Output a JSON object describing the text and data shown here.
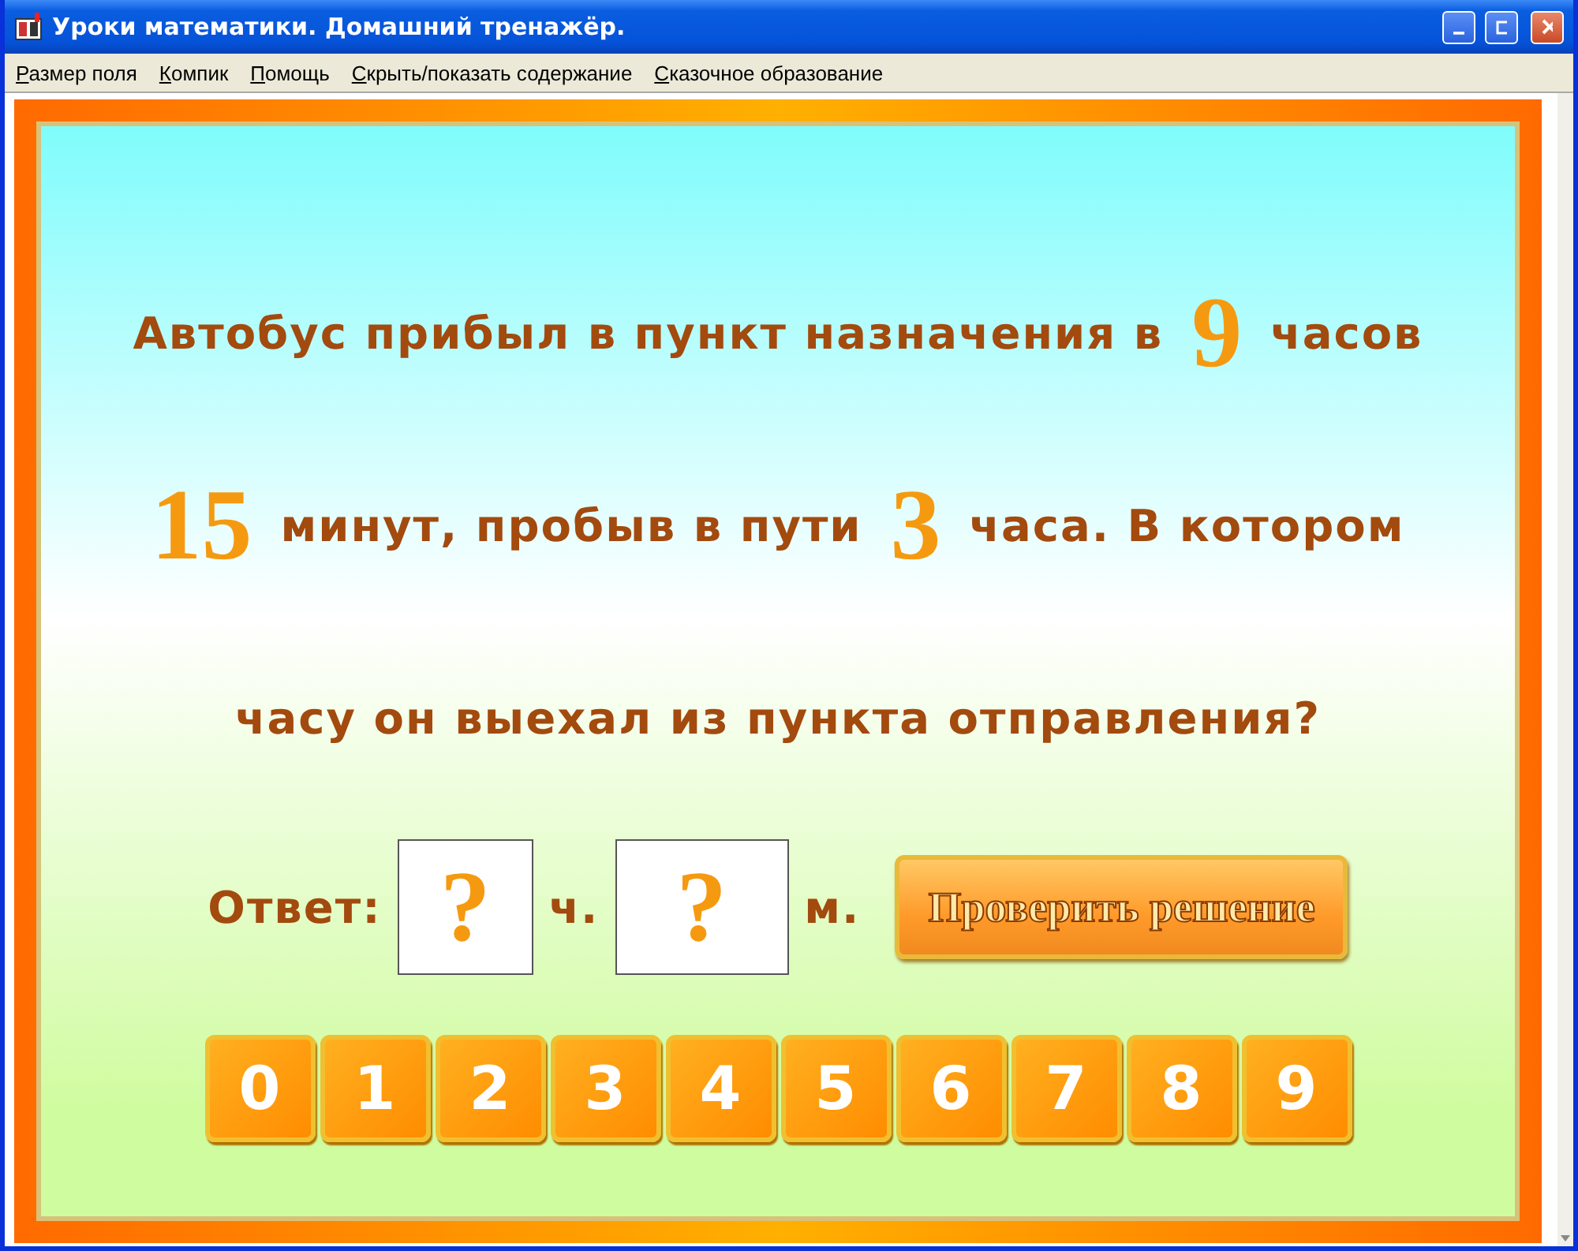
{
  "window": {
    "title": "Уроки математики. Домашний тренажёр."
  },
  "menu": [
    "Размер поля",
    "Компик",
    "Помощь",
    "Скрыть/показать содержание",
    "Сказочное образование"
  ],
  "question": [
    [
      {
        "kind": "text",
        "text": "Автобус прибыл в пункт назначения в"
      },
      {
        "kind": "number",
        "text": "9"
      },
      {
        "kind": "text",
        "text": "часов"
      }
    ],
    [
      {
        "kind": "number",
        "text": "15"
      },
      {
        "kind": "text",
        "text": "минут, пробыв в пути"
      },
      {
        "kind": "number",
        "text": "3"
      },
      {
        "kind": "text",
        "text": "часа. В котором"
      }
    ],
    [
      {
        "kind": "text",
        "text": "часу он выехал из пункта отправления?"
      }
    ]
  ],
  "answer": {
    "label": "Ответ:",
    "hours": {
      "value": "?",
      "unit": "ч."
    },
    "minutes": {
      "value": "?",
      "unit": "м."
    },
    "check_button": "Проверить решение"
  },
  "digits": [
    "0",
    "1",
    "2",
    "3",
    "4",
    "5",
    "6",
    "7",
    "8",
    "9"
  ]
}
